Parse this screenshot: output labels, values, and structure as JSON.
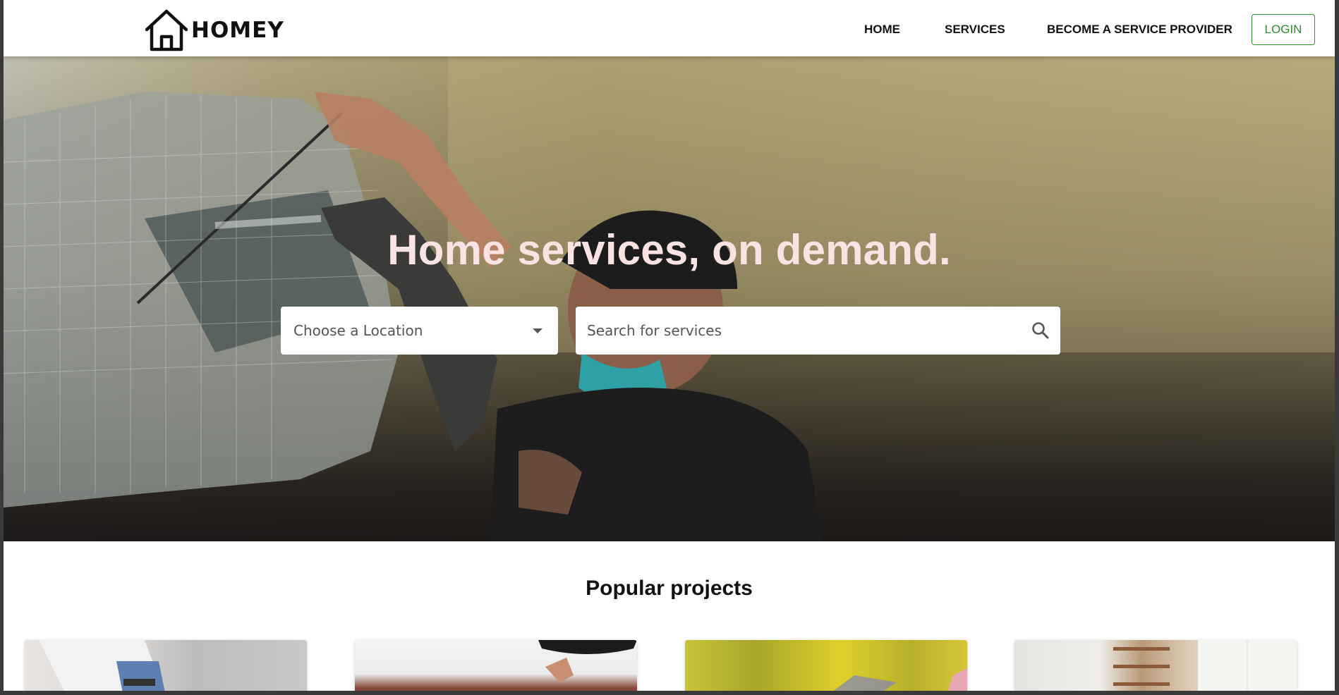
{
  "brand": {
    "name": "HOMEY",
    "logo_icon": "house-icon"
  },
  "nav": {
    "items": [
      {
        "label": "HOME"
      },
      {
        "label": "SERVICES"
      },
      {
        "label": "BECOME A SERVICE PROVIDER"
      }
    ],
    "login_label": "LOGIN"
  },
  "hero": {
    "title": "Home services, on demand.",
    "location": {
      "placeholder": "Choose a Location",
      "icon": "caret-down-icon"
    },
    "search": {
      "placeholder": "Search for services",
      "icon": "search-icon"
    }
  },
  "popular": {
    "title": "Popular projects",
    "cards": [
      {},
      {},
      {},
      {}
    ]
  },
  "colors": {
    "accent": "#2e8b2e",
    "hero_title": "#fbe3e4"
  }
}
